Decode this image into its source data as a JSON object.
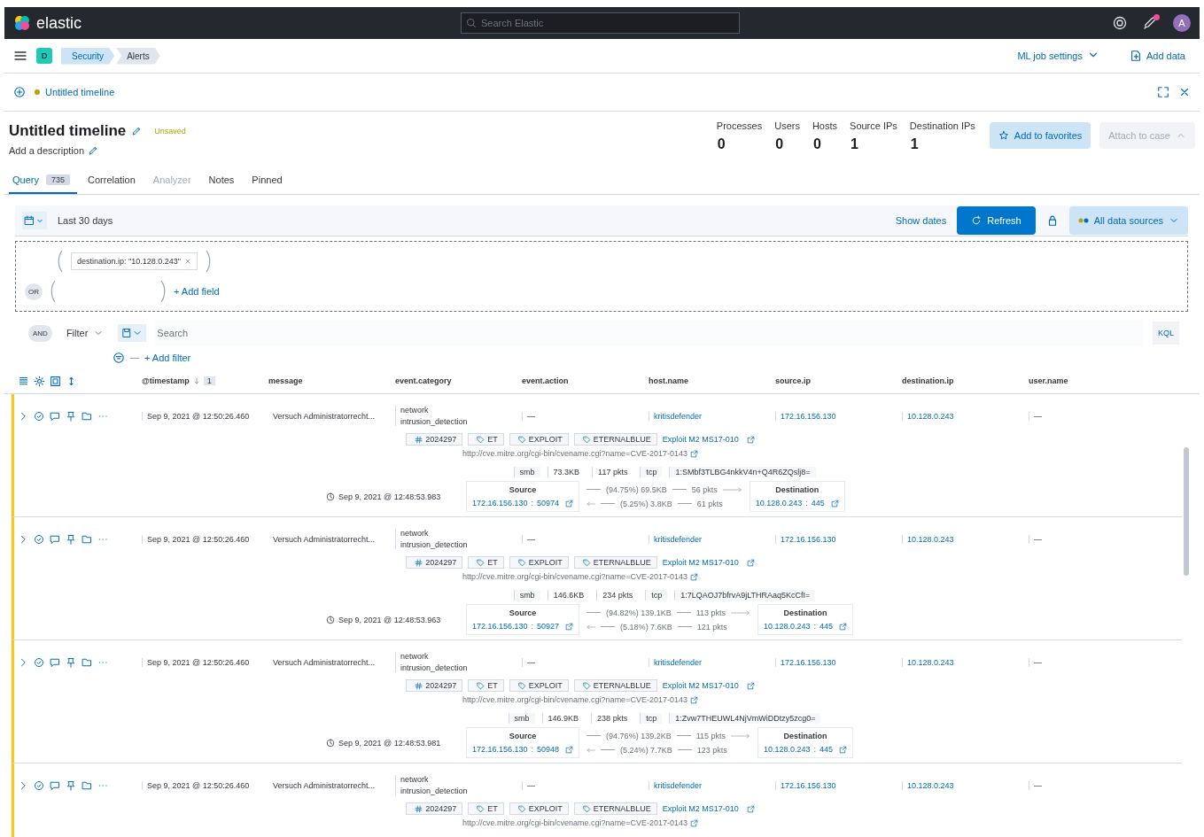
{
  "header": {
    "logo": "elastic",
    "search_placeholder": "Search Elastic",
    "avatar": "A"
  },
  "breadcrumbs": {
    "space": "D",
    "items": [
      "Security",
      "Alerts"
    ]
  },
  "header_links": [
    "ML job settings",
    "Add data"
  ],
  "timeline_bar": {
    "title": "Untitled timeline"
  },
  "timeline": {
    "title": "Untitled timeline",
    "status": "Unsaved",
    "description": "Add a description"
  },
  "stats": [
    {
      "label": "Processes",
      "value": "0"
    },
    {
      "label": "Users",
      "value": "0"
    },
    {
      "label": "Hosts",
      "value": "0"
    },
    {
      "label": "Source IPs",
      "value": "1"
    },
    {
      "label": "Destination IPs",
      "value": "1"
    }
  ],
  "actions": [
    {
      "label": "Add to favorites",
      "disabled": false
    },
    {
      "label": "Attach to case",
      "disabled": true
    }
  ],
  "tabs": [
    {
      "label": "Query",
      "count": "735",
      "selected": true,
      "disabled": false
    },
    {
      "label": "Correlation",
      "selected": false,
      "disabled": false
    },
    {
      "label": "Analyzer",
      "selected": false,
      "disabled": true
    },
    {
      "label": "Notes",
      "selected": false,
      "disabled": false
    },
    {
      "label": "Pinned",
      "selected": false,
      "disabled": false
    }
  ],
  "date_picker": {
    "range": "Last 30 days",
    "show_dates": "Show dates",
    "refresh": "Refresh",
    "data_sources": "All data sources"
  },
  "query_builder": {
    "chip": "destination.ip: \"10.128.0.243\"",
    "or_label": "OR",
    "add_field": "+ Add field"
  },
  "filter_bar": {
    "and_label": "AND",
    "filter": "Filter",
    "placeholder": "Search",
    "language": "KQL",
    "add_filter": "+ Add filter"
  },
  "columns": [
    {
      "label": "@timestamp",
      "sort_order": "1"
    },
    {
      "label": "message"
    },
    {
      "label": "event.category"
    },
    {
      "label": "event.action"
    },
    {
      "label": "host.name"
    },
    {
      "label": "source.ip"
    },
    {
      "label": "destination.ip"
    },
    {
      "label": "user.name"
    }
  ],
  "events": [
    {
      "timestamp": "Sep 9, 2021 @ 12:50:26.460",
      "message": "Versuch Administratorrecht...",
      "category": [
        "network",
        "intrusion_detection"
      ],
      "action": "—",
      "host": "kritisdefender",
      "source_ip": "172.16.156.130",
      "destination_ip": "10.128.0.243",
      "user": "—",
      "signature_id": "2024297",
      "tags": [
        "ET",
        "EXPLOIT",
        "ETERNALBLUE"
      ],
      "rule_link": "Exploit M2 MS17-010",
      "reference": "http://cve.mitre.org/cgi-bin/cvename.cgi?name=CVE-2017-0143",
      "netflow": {
        "protocol": "smb",
        "bytes": "73.3KB",
        "packets": "117 pkts",
        "transport": "tcp",
        "community_id": "1:SMbf3TLBG4nkkV4n+Q4R6ZQslj8=",
        "time": "Sep 9, 2021 @ 12:48:53.983",
        "source_label": "Source",
        "source_ip": "172.16.156.130",
        "separator": ":",
        "source_port": "50974",
        "out_percent": "(94.75%)",
        "out_bytes": "69.5KB",
        "out_packets": "56 pkts",
        "in_percent": "(5.25%)",
        "in_bytes": "3.8KB",
        "in_packets": "61 pkts",
        "destination_label": "Destination",
        "destination_ip": "10.128.0.243",
        "destination_port": "445"
      }
    },
    {
      "timestamp": "Sep 9, 2021 @ 12:50:26.460",
      "message": "Versuch Administratorrecht...",
      "category": [
        "network",
        "intrusion_detection"
      ],
      "action": "—",
      "host": "kritisdefender",
      "source_ip": "172.16.156.130",
      "destination_ip": "10.128.0.243",
      "user": "—",
      "signature_id": "2024297",
      "tags": [
        "ET",
        "EXPLOIT",
        "ETERNALBLUE"
      ],
      "rule_link": "Exploit M2 MS17-010",
      "reference": "http://cve.mitre.org/cgi-bin/cvename.cgi?name=CVE-2017-0143",
      "netflow": {
        "protocol": "smb",
        "bytes": "146.6KB",
        "packets": "234 pkts",
        "transport": "tcp",
        "community_id": "1:7LQAOJ7bfrvA9jLTHRAaq5KcCfI=",
        "time": "Sep 9, 2021 @ 12:48:53.963",
        "source_label": "Source",
        "source_ip": "172.16.156.130",
        "separator": ":",
        "source_port": "50927",
        "out_percent": "(94.82%)",
        "out_bytes": "139.1KB",
        "out_packets": "113 pkts",
        "in_percent": "(5.18%)",
        "in_bytes": "7.6KB",
        "in_packets": "121 pkts",
        "destination_label": "Destination",
        "destination_ip": "10.128.0.243",
        "destination_port": "445"
      }
    },
    {
      "timestamp": "Sep 9, 2021 @ 12:50:26.460",
      "message": "Versuch Administratorrecht...",
      "category": [
        "network",
        "intrusion_detection"
      ],
      "action": "—",
      "host": "kritisdefender",
      "source_ip": "172.16.156.130",
      "destination_ip": "10.128.0.243",
      "user": "—",
      "signature_id": "2024297",
      "tags": [
        "ET",
        "EXPLOIT",
        "ETERNALBLUE"
      ],
      "rule_link": "Exploit M2 MS17-010",
      "reference": "http://cve.mitre.org/cgi-bin/cvename.cgi?name=CVE-2017-0143",
      "netflow": {
        "protocol": "smb",
        "bytes": "146.9KB",
        "packets": "238 pkts",
        "transport": "tcp",
        "community_id": "1:Zvw7THEUWL4NjVmWiDDtzy5zcg0=",
        "time": "Sep 9, 2021 @ 12:48:53.981",
        "source_label": "Source",
        "source_ip": "172.16.156.130",
        "separator": ":",
        "source_port": "50948",
        "out_percent": "(94.76%)",
        "out_bytes": "139.2KB",
        "out_packets": "115 pkts",
        "in_percent": "(5.24%)",
        "in_bytes": "7.7KB",
        "in_packets": "123 pkts",
        "destination_label": "Destination",
        "destination_ip": "10.128.0.243",
        "destination_port": "445"
      }
    },
    {
      "timestamp": "Sep 9, 2021 @ 12:50:26.460",
      "message": "Versuch Administratorrecht...",
      "category": [
        "network",
        "intrusion_detection"
      ],
      "action": "—",
      "host": "kritisdefender",
      "source_ip": "172.16.156.130",
      "destination_ip": "10.128.0.243",
      "user": "—",
      "signature_id": "2024297",
      "tags": [
        "ET",
        "EXPLOIT",
        "ETERNALBLUE"
      ],
      "rule_link": "Exploit M2 MS17-010",
      "reference": "http://cve.mitre.org/cgi-bin/cvename.cgi?name=CVE-2017-0143"
    }
  ]
}
